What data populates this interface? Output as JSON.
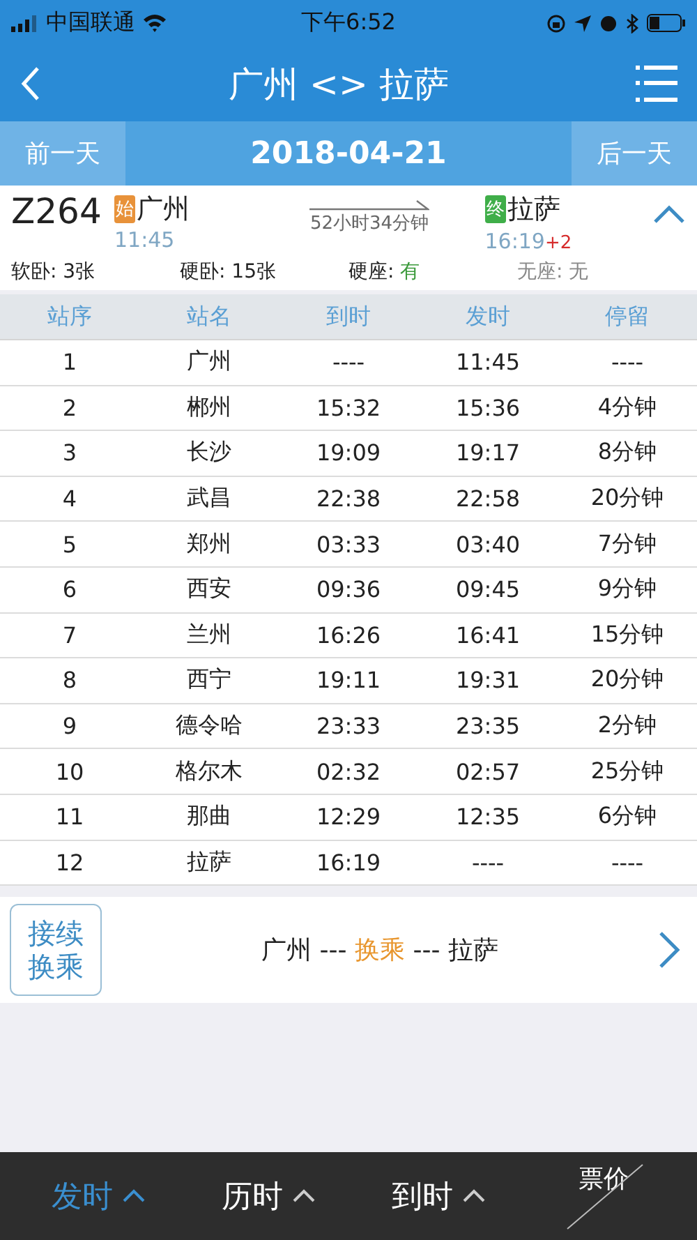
{
  "status_bar": {
    "carrier": "中国联通",
    "time": "下午6:52"
  },
  "nav": {
    "title": "广州 <> 拉萨"
  },
  "date_bar": {
    "prev": "前一天",
    "date": "2018-04-21",
    "next": "后一天"
  },
  "train": {
    "number": "Z264",
    "from_badge": "始",
    "from": "广州",
    "depart": "11:45",
    "duration": "52小时34分钟",
    "to_badge": "终",
    "to": "拉萨",
    "arrive": "16:19",
    "day_offset": "+2",
    "expanded": true
  },
  "seats": [
    {
      "label": "软卧: ",
      "value": "3张",
      "kind": "count"
    },
    {
      "label": "硬卧: ",
      "value": "15张",
      "kind": "count"
    },
    {
      "label": "硬座: ",
      "value": "有",
      "kind": "yes"
    },
    {
      "label": "无座: ",
      "value": "无",
      "kind": "none"
    }
  ],
  "table": {
    "columns": [
      "站序",
      "站名",
      "到时",
      "发时",
      "停留"
    ],
    "rows": [
      [
        "1",
        "广州",
        "----",
        "11:45",
        "----"
      ],
      [
        "2",
        "郴州",
        "15:32",
        "15:36",
        "4分钟"
      ],
      [
        "3",
        "长沙",
        "19:09",
        "19:17",
        "8分钟"
      ],
      [
        "4",
        "武昌",
        "22:38",
        "22:58",
        "20分钟"
      ],
      [
        "5",
        "郑州",
        "03:33",
        "03:40",
        "7分钟"
      ],
      [
        "6",
        "西安",
        "09:36",
        "09:45",
        "9分钟"
      ],
      [
        "7",
        "兰州",
        "16:26",
        "16:41",
        "15分钟"
      ],
      [
        "8",
        "西宁",
        "19:11",
        "19:31",
        "20分钟"
      ],
      [
        "9",
        "德令哈",
        "23:33",
        "23:35",
        "2分钟"
      ],
      [
        "10",
        "格尔木",
        "02:32",
        "02:57",
        "25分钟"
      ],
      [
        "11",
        "那曲",
        "12:29",
        "12:35",
        "6分钟"
      ],
      [
        "12",
        "拉萨",
        "16:19",
        "----",
        "----"
      ]
    ]
  },
  "transfer": {
    "button": [
      "接续",
      "换乘"
    ],
    "route": [
      "广州 --- ",
      "换乘",
      " --- 拉萨"
    ]
  },
  "sort_bar": [
    {
      "label": "发时",
      "selected": true
    },
    {
      "label": "历时",
      "selected": false
    },
    {
      "label": "到时",
      "selected": false
    },
    {
      "label": "票价",
      "selected": false
    }
  ]
}
